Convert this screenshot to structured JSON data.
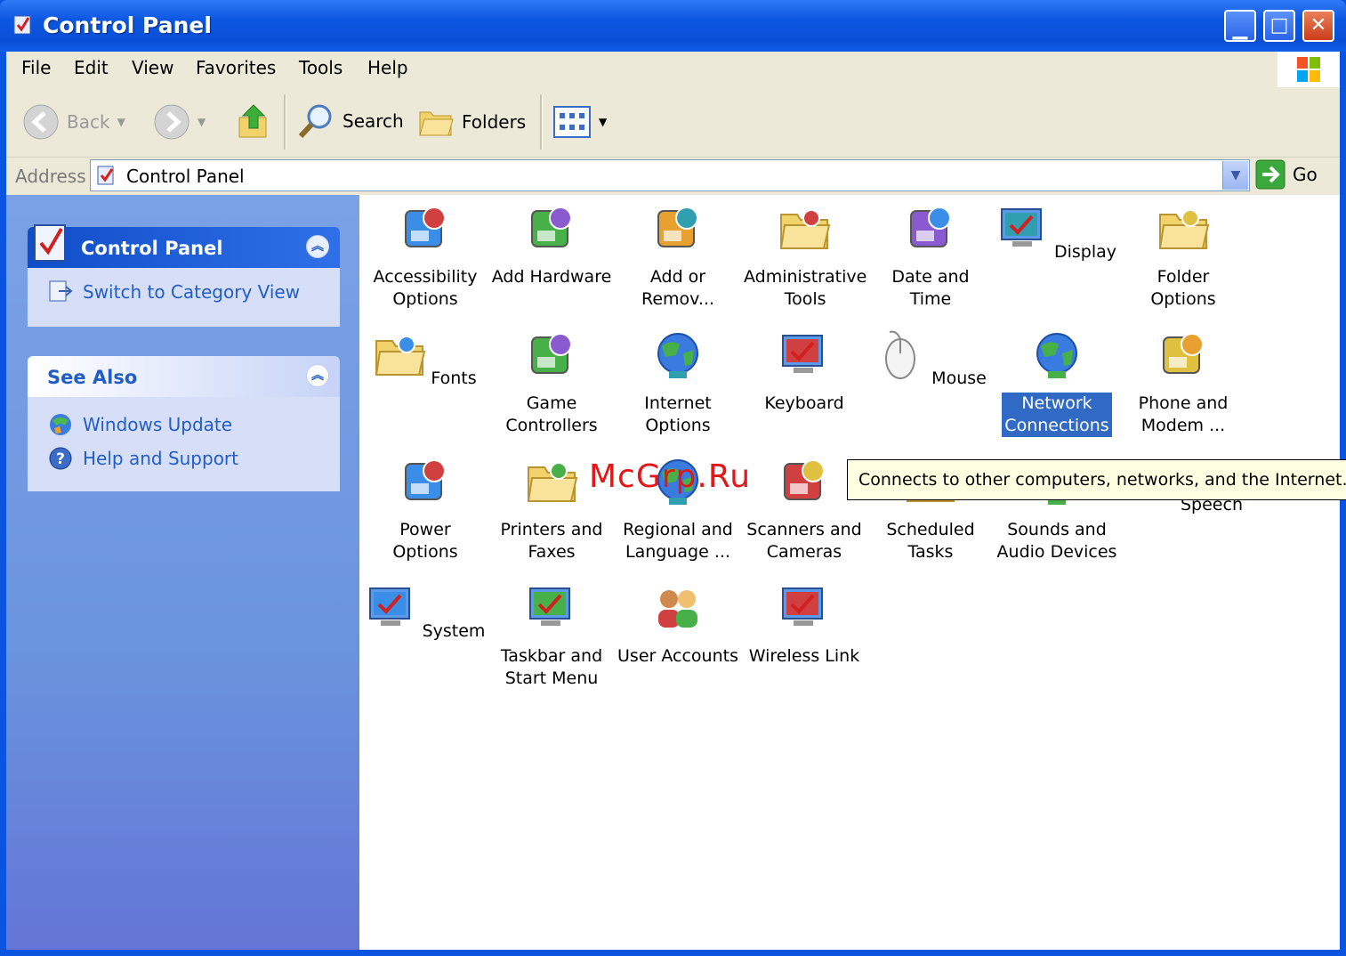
{
  "window": {
    "title": "Control Panel"
  },
  "menu": [
    "File",
    "Edit",
    "View",
    "Favorites",
    "Tools",
    "Help"
  ],
  "toolbar": {
    "back": "Back",
    "search": "Search",
    "folders": "Folders"
  },
  "address": {
    "label": "Address",
    "value": "Control Panel",
    "go": "Go"
  },
  "left_pane": {
    "control_panel": {
      "title": "Control Panel",
      "switch_link": "Switch to Category View"
    },
    "see_also": {
      "title": "See Also",
      "links": [
        "Windows Update",
        "Help and Support"
      ]
    }
  },
  "icons": [
    {
      "label": "Accessibility\nOptions",
      "icon": "accessibility-icon"
    },
    {
      "label": "Add Hardware",
      "icon": "add-hardware-icon"
    },
    {
      "label": "Add or\nRemov...",
      "icon": "add-remove-programs-icon"
    },
    {
      "label": "Administrative\nTools",
      "icon": "administrative-tools-icon"
    },
    {
      "label": "Date and Time",
      "icon": "date-time-icon"
    },
    {
      "label": "Display",
      "icon": "display-icon"
    },
    {
      "label": "Folder Options",
      "icon": "folder-options-icon"
    },
    {
      "label": "Fonts",
      "icon": "fonts-icon"
    },
    {
      "label": "Game\nControllers",
      "icon": "game-controllers-icon"
    },
    {
      "label": "Internet\nOptions",
      "icon": "internet-options-icon"
    },
    {
      "label": "Keyboard",
      "icon": "keyboard-icon"
    },
    {
      "label": "Mouse",
      "icon": "mouse-icon"
    },
    {
      "label": "Network\nConnections",
      "icon": "network-connections-icon",
      "selected": true
    },
    {
      "label": "Phone and\nModem ...",
      "icon": "phone-modem-icon"
    },
    {
      "label": "Power Options",
      "icon": "power-options-icon"
    },
    {
      "label": "Printers and\nFaxes",
      "icon": "printers-faxes-icon"
    },
    {
      "label": "Regional and\nLanguage ...",
      "icon": "regional-language-icon"
    },
    {
      "label": "Scanners and\nCameras",
      "icon": "scanners-cameras-icon"
    },
    {
      "label": "Scheduled\nTasks",
      "icon": "scheduled-tasks-icon"
    },
    {
      "label": "Sounds and\nAudio Devices",
      "icon": "sounds-audio-icon"
    },
    {
      "label": "Speech",
      "icon": "speech-icon"
    },
    {
      "label": "System",
      "icon": "system-icon"
    },
    {
      "label": "Taskbar and\nStart Menu",
      "icon": "taskbar-start-menu-icon"
    },
    {
      "label": "User Accounts",
      "icon": "user-accounts-icon"
    },
    {
      "label": "Wireless Link",
      "icon": "wireless-link-icon"
    }
  ],
  "tooltip": "Connects to other computers, networks, and the Internet.",
  "watermark": "McGrp.Ru",
  "colors": {
    "title_bar": "#0a54e0",
    "selection": "#316ac5",
    "left_pane": "#6a94dd",
    "link": "#215dc6"
  }
}
